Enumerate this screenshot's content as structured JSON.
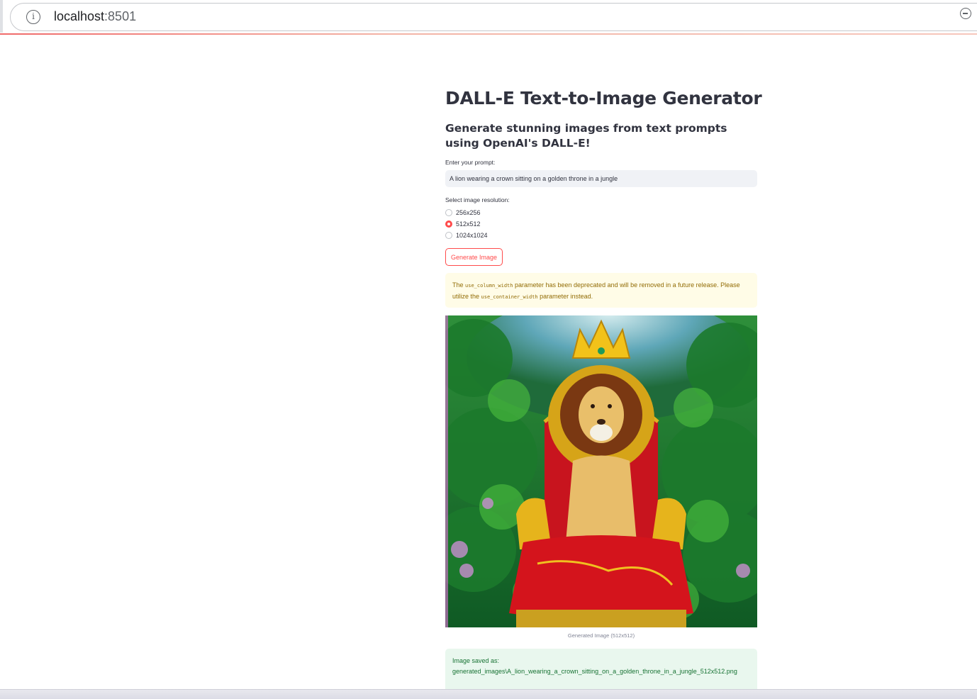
{
  "browser": {
    "url_host": "localhost",
    "url_port": ":8501"
  },
  "app": {
    "title": "DALL-E Text-to-Image Generator",
    "subtitle": "Generate stunning images from text prompts using OpenAI's DALL-E!",
    "prompt_label": "Enter your prompt:",
    "prompt_value": "A lion wearing a crown sitting on a golden throne in a jungle",
    "resolution_label": "Select image resolution:",
    "resolution_options": [
      "256x256",
      "512x512",
      "1024x1024"
    ],
    "resolution_selected": "512x512",
    "generate_button": "Generate Image",
    "warning": {
      "prefix": "The",
      "code1": "use_column_width",
      "middle": "parameter has been deprecated and will be removed in a future release. Please utilize the",
      "code2": "use_container_width",
      "suffix": "parameter instead."
    },
    "image_caption": "Generated Image (512x512)",
    "success": {
      "line1": "Image saved as:",
      "path": "generated_images\\A_lion_wearing_a_crown_sitting_on_a_golden_throne_in_a_jungle_512x512.png"
    }
  },
  "colors": {
    "primary": "#ff4b4b",
    "warning_bg": "#fffce7",
    "success_bg": "#e9f7ee"
  }
}
